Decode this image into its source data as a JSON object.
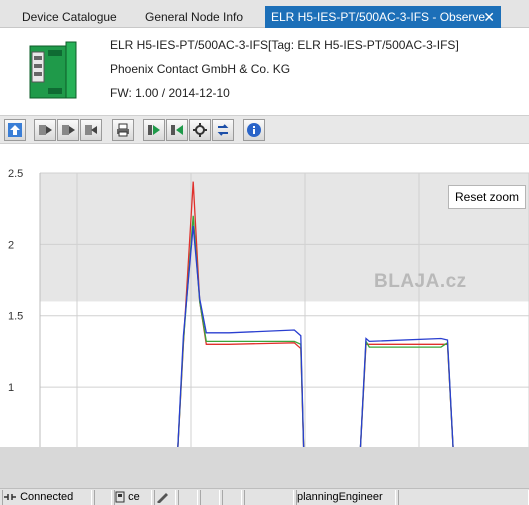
{
  "tabs": [
    {
      "label": "Device Catalogue",
      "active": false
    },
    {
      "label": "General Node Info",
      "active": false
    },
    {
      "label": "ELR H5-IES-PT/500AC-3-IFS - Observe",
      "active": true
    }
  ],
  "tab_close_glyph": "✕",
  "device": {
    "name_line": "ELR H5-IES-PT/500AC-3-IFS[Tag: ELR H5-IES-PT/500AC-3-IFS]",
    "vendor": "Phoenix Contact GmbH & Co. KG",
    "firmware": "FW: 1.00 / 2014-12-10",
    "image_icon": "device-module-icon"
  },
  "toolbar": {
    "buttons": [
      "home-icon",
      "upload-icon",
      "upload-icon",
      "upload-icon",
      "print-icon",
      "play-icon",
      "step-icon",
      "config-icon",
      "transfer-icon",
      "info-icon"
    ]
  },
  "chart_data": {
    "type": "line",
    "y_ticks": [
      "2.5",
      "2",
      "1.5",
      "1"
    ],
    "ylim": [
      0.58,
      2.5
    ],
    "xlim": [
      0,
      100
    ],
    "highlight_band": [
      1.6,
      2.5
    ],
    "grid": true,
    "series": [
      {
        "color": "#e0302c",
        "x": [
          0,
          42,
          44,
          47,
          49,
          51,
          53,
          55,
          58,
          78,
          80,
          81,
          82,
          95,
          98,
          100,
          101,
          123,
          125,
          127,
          128,
          140,
          145,
          150
        ],
        "y": [
          0.45,
          0.45,
          1.3,
          2.44,
          1.6,
          1.3,
          1.3,
          1.3,
          1.3,
          1.31,
          1.27,
          0.45,
          0.45,
          0.45,
          0.45,
          1.3,
          1.3,
          1.3,
          1.3,
          0.45,
          0.45,
          0.45,
          0.45,
          0.45
        ]
      },
      {
        "color": "#3aa53a",
        "x": [
          0,
          42,
          44,
          47,
          49,
          51,
          53,
          55,
          58,
          78,
          80,
          81,
          82,
          95,
          98,
          100,
          101,
          123,
          125,
          127,
          128,
          140,
          145,
          150
        ],
        "y": [
          0.45,
          0.45,
          1.32,
          2.2,
          1.6,
          1.32,
          1.32,
          1.32,
          1.32,
          1.32,
          1.3,
          0.45,
          0.45,
          0.45,
          0.45,
          1.32,
          1.28,
          1.28,
          1.31,
          0.45,
          0.45,
          0.45,
          0.45,
          0.45
        ]
      },
      {
        "color": "#2a3fd0",
        "x": [
          0,
          42,
          44,
          47,
          49,
          51,
          53,
          55,
          58,
          78,
          80,
          81,
          82,
          95,
          98,
          100,
          101,
          123,
          125,
          127,
          128,
          140,
          145,
          150
        ],
        "y": [
          0.45,
          0.45,
          1.36,
          2.13,
          1.62,
          1.38,
          1.38,
          1.38,
          1.38,
          1.4,
          1.36,
          0.45,
          0.45,
          0.45,
          0.45,
          1.34,
          1.32,
          1.34,
          1.33,
          0.45,
          0.45,
          0.45,
          0.45,
          0.45
        ]
      }
    ]
  },
  "chart": {
    "reset_zoom_label": "Reset zoom",
    "watermark": "BLAJA.cz"
  },
  "status": {
    "connection": "Connected",
    "mode_text": "ce",
    "user": "planningEngineer"
  }
}
